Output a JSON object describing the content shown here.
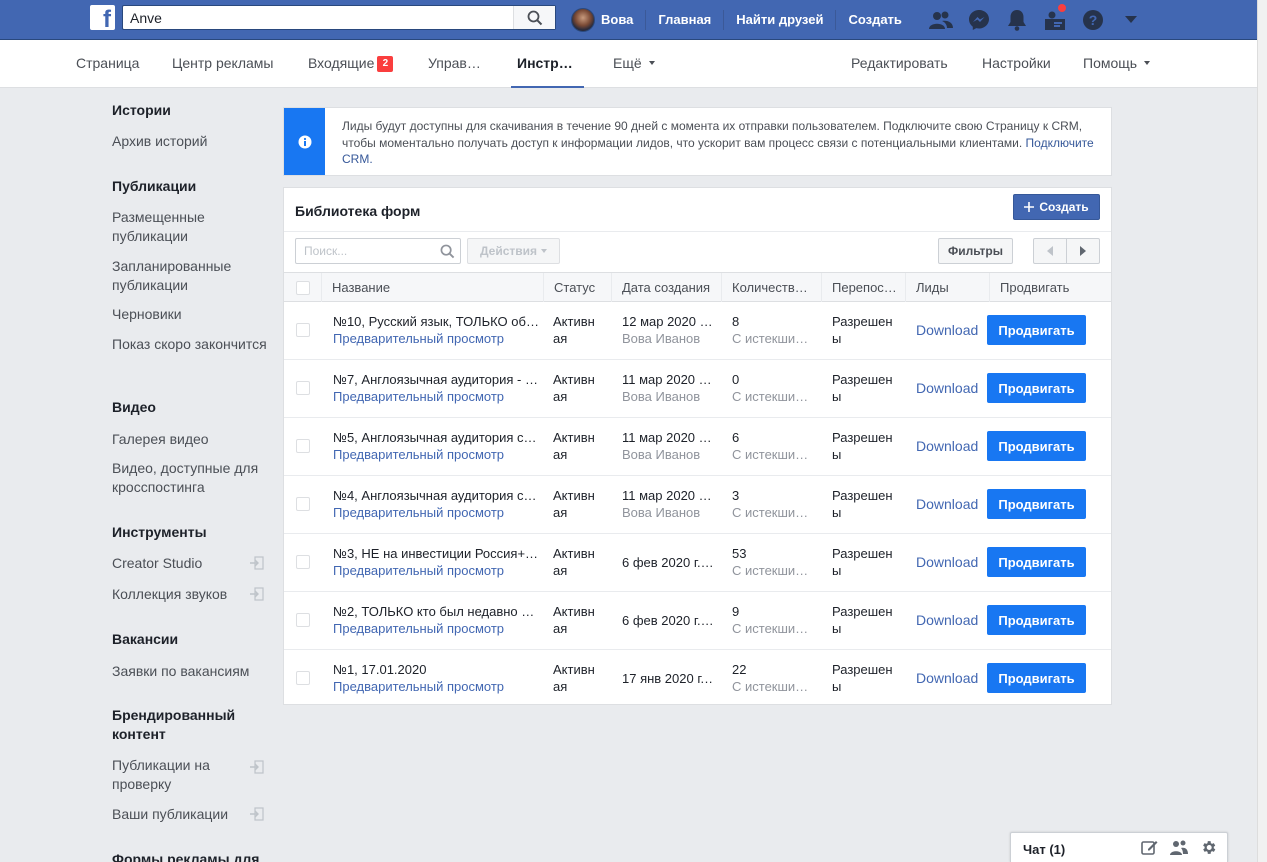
{
  "topbar": {
    "logo": "f",
    "search_value": "Anve",
    "profile_name": "Вова",
    "nav": [
      "Главная",
      "Найти друзей",
      "Создать"
    ]
  },
  "pagebar": {
    "tabs": [
      {
        "label": "Страница"
      },
      {
        "label": "Центр рекламы"
      },
      {
        "label": "Входящие",
        "badge": "2"
      },
      {
        "label": "Управ…"
      },
      {
        "label": "Инстр…"
      },
      {
        "label": "Ещё"
      }
    ],
    "right": [
      "Редактировать",
      "Настройки",
      "Помощь"
    ]
  },
  "sidebar": {
    "stories": {
      "title": "Истории",
      "items": [
        "Архив историй"
      ]
    },
    "publications": {
      "title": "Публикации",
      "items": [
        "Размещенные публикации",
        "Запланированные публикации",
        "Черновики",
        "Показ скоро закончится"
      ]
    },
    "video": {
      "title": "Видео",
      "items": [
        "Галерея видео",
        "Видео, доступные для кросспостинга"
      ]
    },
    "tools": {
      "title": "Инструменты",
      "items": [
        "Creator Studio",
        "Коллекция звуков"
      ]
    },
    "vacancies": {
      "title": "Вакансии",
      "items": [
        "Заявки по вакансиям"
      ]
    },
    "branded": {
      "title": "Брендированный контент",
      "items": [
        "Публикации на проверку",
        "Ваши публикации"
      ]
    },
    "lead_forms": {
      "title": "Формы рекламы для"
    }
  },
  "info": {
    "text": "Лиды будут доступны для скачивания в течение 90 дней с момента их отправки пользователем. Подключите свою Страницу к CRM, чтобы моментально получать доступ к информации лидов, что ускорит вам процесс связи с потенциальными клиентами.",
    "link": "Подключите CRM."
  },
  "forms": {
    "title": "Библиотека форм",
    "create_label": "Создать",
    "search_placeholder": "Поиск...",
    "actions_label": "Действия",
    "filters_label": "Фильтры",
    "columns": [
      "Название",
      "Статус",
      "Дата создания",
      "Количеств…",
      "Перепос…",
      "Лиды",
      "Продвигать"
    ],
    "rows": [
      {
        "name": "№10, Русский язык, ТОЛЬКО об…",
        "preview": "Предварительный просмотр",
        "status": [
          "Активн",
          "ая"
        ],
        "date": "12 мар 2020 …",
        "author": "Вова Иванов",
        "count": "8",
        "count_sub": "С истекши…",
        "share": [
          "Разрешен",
          "ы"
        ],
        "leads": "Download",
        "promote": "Продвигать"
      },
      {
        "name": "№7, Англоязычная аудитория - …",
        "preview": "Предварительный просмотр",
        "status": [
          "Активн",
          "ая"
        ],
        "date": "11 мар 2020 …",
        "author": "Вова Иванов",
        "count": "0",
        "count_sub": "С истекши…",
        "share": [
          "Разрешен",
          "ы"
        ],
        "leads": "Download",
        "promote": "Продвигать"
      },
      {
        "name": "№5, Англоязычная аудитория с…",
        "preview": "Предварительный просмотр",
        "status": [
          "Активн",
          "ая"
        ],
        "date": "11 мар 2020 …",
        "author": "Вова Иванов",
        "count": "6",
        "count_sub": "С истекши…",
        "share": [
          "Разрешен",
          "ы"
        ],
        "leads": "Download",
        "promote": "Продвигать"
      },
      {
        "name": "№4, Англоязычная аудитория с…",
        "preview": "Предварительный просмотр",
        "status": [
          "Активн",
          "ая"
        ],
        "date": "11 мар 2020 …",
        "author": "Вова Иванов",
        "count": "3",
        "count_sub": "С истекши…",
        "share": [
          "Разрешен",
          "ы"
        ],
        "leads": "Download",
        "promote": "Продвигать"
      },
      {
        "name": "№3, НЕ на инвестиции Россия+…",
        "preview": "Предварительный просмотр",
        "status": [
          "Активн",
          "ая"
        ],
        "date": "6 фев 2020 г.…",
        "author": "",
        "count": "53",
        "count_sub": "С истекши…",
        "share": [
          "Разрешен",
          "ы"
        ],
        "leads": "Download",
        "promote": "Продвигать"
      },
      {
        "name": "№2, ТОЛЬКО кто был недавно …",
        "preview": "Предварительный просмотр",
        "status": [
          "Активн",
          "ая"
        ],
        "date": "6 фев 2020 г.…",
        "author": "",
        "count": "9",
        "count_sub": "С истекши…",
        "share": [
          "Разрешен",
          "ы"
        ],
        "leads": "Download",
        "promote": "Продвигать"
      },
      {
        "name": "№1, 17.01.2020",
        "preview": "Предварительный просмотр",
        "status": [
          "Активн",
          "ая"
        ],
        "date": "17 янв 2020 г.…",
        "author": "",
        "count": "22",
        "count_sub": "С истекши…",
        "share": [
          "Разрешен",
          "ы"
        ],
        "leads": "Download",
        "promote": "Продвигать"
      }
    ]
  },
  "chat": {
    "label": "Чат (1)"
  },
  "icons": [
    "facebook-logo",
    "search-icon",
    "friend-requests-icon",
    "messenger-icon",
    "notifications-icon",
    "page-manager-icon",
    "help-icon",
    "account-menu-caret-icon",
    "info-icon",
    "plus-icon",
    "chevron-left-icon",
    "chevron-right-icon",
    "external-link-icon",
    "compose-icon",
    "group-chat-icon",
    "settings-gear-icon"
  ],
  "colors": {
    "brand": "#4267b2",
    "primary_button": "#1877f2",
    "badge": "#fa3e3e",
    "link": "#4267b2"
  }
}
